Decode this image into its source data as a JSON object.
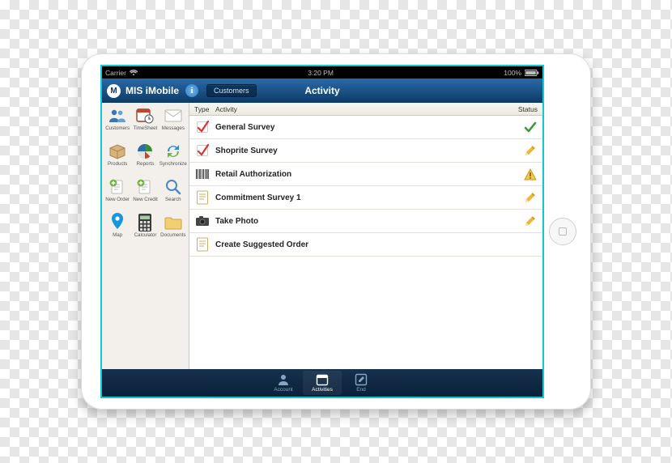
{
  "statusbar": {
    "carrier": "Carrier",
    "time": "3:20 PM",
    "battery": "100%"
  },
  "navbar": {
    "app_title": "MIS iMobile",
    "breadcrumb_button": "Customers",
    "page_title": "Activity"
  },
  "sidebar": {
    "items": [
      {
        "label": "Customers",
        "icon": "people-icon"
      },
      {
        "label": "TimeSheet",
        "icon": "calendar-clock-icon"
      },
      {
        "label": "Messages",
        "icon": "envelope-icon"
      },
      {
        "label": "Products",
        "icon": "box-icon"
      },
      {
        "label": "Reports",
        "icon": "piechart-icon"
      },
      {
        "label": "Synchronize",
        "icon": "sync-icon"
      },
      {
        "label": "New Order",
        "icon": "new-order-icon"
      },
      {
        "label": "New Credit",
        "icon": "new-credit-icon"
      },
      {
        "label": "Search",
        "icon": "search-icon"
      },
      {
        "label": "Map",
        "icon": "pin-icon"
      },
      {
        "label": "Calculator",
        "icon": "calculator-icon"
      },
      {
        "label": "Documents",
        "icon": "folder-icon"
      }
    ]
  },
  "table": {
    "headers": {
      "type": "Type",
      "activity": "Activity",
      "status": "Status"
    },
    "rows": [
      {
        "type_icon": "checkbox-red-icon",
        "name": "General Survey",
        "status_icon": "check-green-icon"
      },
      {
        "type_icon": "checkbox-red-icon",
        "name": "Shoprite Survey",
        "status_icon": "pencil-icon"
      },
      {
        "type_icon": "barcode-icon",
        "name": "Retail Authorization",
        "status_icon": "warning-icon"
      },
      {
        "type_icon": "note-icon",
        "name": "Commitment Survey 1",
        "status_icon": "pencil-icon"
      },
      {
        "type_icon": "camera-icon",
        "name": "Take Photo",
        "status_icon": "pencil-icon"
      },
      {
        "type_icon": "note-icon",
        "name": "Create Suggested Order",
        "status_icon": ""
      }
    ]
  },
  "toolbar": {
    "items": [
      {
        "label": "Account",
        "icon": "person-icon",
        "active": false
      },
      {
        "label": "Activities",
        "icon": "calendar-icon",
        "active": true
      },
      {
        "label": "End",
        "icon": "edit-icon",
        "active": false
      }
    ]
  },
  "colors": {
    "nav": "#0d3a66",
    "teal": "#11c7d4"
  }
}
